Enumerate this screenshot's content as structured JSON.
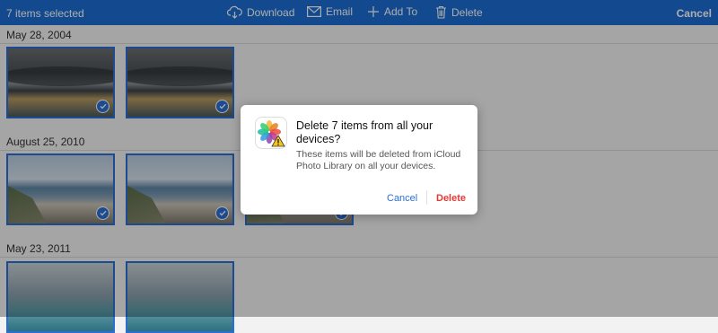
{
  "toolbar": {
    "selection_text": "7 items selected",
    "download_label": "Download",
    "email_label": "Email",
    "add_to_label": "Add To",
    "delete_label": "Delete",
    "cancel_label": "Cancel",
    "accent_color": "#1c6ed3"
  },
  "groups": [
    {
      "date": "May 28, 2004",
      "photos": [
        {
          "kind": "storm",
          "selected": true
        },
        {
          "kind": "storm",
          "selected": true
        }
      ]
    },
    {
      "date": "August 25, 2010",
      "photos": [
        {
          "kind": "beach",
          "selected": true
        },
        {
          "kind": "beach",
          "selected": true
        },
        {
          "kind": "beach",
          "selected": true
        }
      ]
    },
    {
      "date": "May 23, 2011",
      "photos": [
        {
          "kind": "teal",
          "selected": true
        },
        {
          "kind": "teal",
          "selected": true
        }
      ]
    }
  ],
  "dialog": {
    "icon": "photos-warning-icon",
    "title": "Delete 7 items from all your devices?",
    "message": "These items will be deleted from iCloud Photo Library on all your devices.",
    "cancel_label": "Cancel",
    "delete_label": "Delete",
    "delete_color": "#e53935"
  }
}
